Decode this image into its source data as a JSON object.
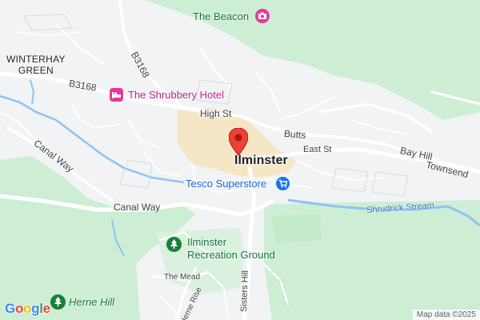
{
  "map": {
    "town": "Ilminster",
    "places": {
      "winterhay_line1": "WINTERHAY",
      "winterhay_line2": "GREEN"
    },
    "roads": {
      "b3168_west": "B3168",
      "b3168_north": "B3168",
      "high_st": "High St",
      "butts": "Butts",
      "east_st": "East St",
      "bay_hill": "Bay Hill",
      "townsend": "Townsend",
      "canal_way_1": "Canal Way",
      "canal_way_2": "Canal Way",
      "the_mead": "The Mead",
      "herne_rise": "Herne Rise",
      "sisters_hill": "Sisters Hill"
    },
    "pois": {
      "the_beacon": "The Beacon",
      "shrubbery_hotel": "The Shrubbery Hotel",
      "tesco": "Tesco Superstore",
      "recreation_line1": "Ilminster",
      "recreation_line2": "Recreation Ground",
      "herne_hill": "Herne Hill"
    },
    "water": {
      "shrudrick_stream": "Shrudrick Stream"
    },
    "attribution": "Map data ©2025",
    "logo": {
      "letters": [
        "G",
        "o",
        "o",
        "g",
        "l",
        "e"
      ],
      "colors": [
        "#4285F4",
        "#EA4335",
        "#FBBC05",
        "#4285F4",
        "#34A853",
        "#EA4335"
      ]
    },
    "colors": {
      "land": "#f1f3f4",
      "green": "#cdeed4",
      "water": "#8ec3f5",
      "urban": "#f5e7c6",
      "pin": "#ea4335",
      "park_icon": "#188038",
      "hotel_icon": "#e8379a",
      "shop_icon": "#1a73e8"
    }
  }
}
